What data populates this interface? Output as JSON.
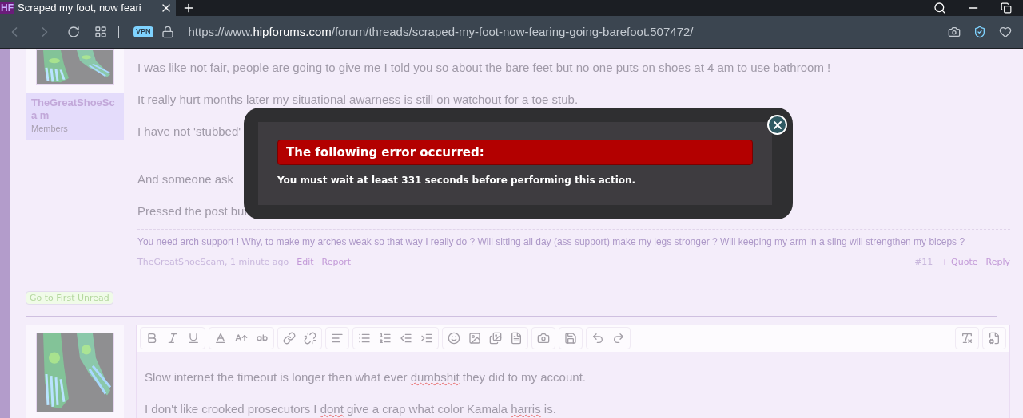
{
  "browser": {
    "tab": {
      "title": "Scraped my foot, now feari",
      "logo": "HF"
    },
    "address": {
      "vpn": "VPN",
      "prefix": "https://www.",
      "host": "hipforums.com",
      "path": "/forum/threads/scraped-my-foot-now-fearing-going-barefoot.507472/"
    }
  },
  "post": {
    "author": "TheGreatShoeSca m",
    "role": "Members",
    "paragraphs": [
      {
        "segments": [
          "I was like not fair, people are going to give me I told you so about the bare feet but no one puts on shoes at 4 am to use bathroom !"
        ]
      },
      {
        "segments": [
          "It really hurt months later my situational awarness is still on watchout for a toe stub."
        ]
      },
      {
        "segments": [
          "I have not 'stubbed'"
        ]
      },
      {
        "segments": [
          "And someone ask"
        ]
      },
      {
        "segments": [
          "Pressed the post but"
        ]
      }
    ],
    "signature": "You need arch support ! Why, to make my arches weak so that way I really do ? Will sitting all day (ass support) make my legs stronger ? Will keeping my arm in a sling will strengthen my biceps ?",
    "meta": {
      "byline": "TheGreatShoeScam, 1 minute ago",
      "links": [
        "Edit",
        "Report"
      ],
      "number": "#11",
      "actions": [
        "+ Quote",
        "Reply"
      ]
    }
  },
  "first_unread_button": "Go to First Unread",
  "editor": {
    "paragraphs": [
      [
        {
          "text": "Slow internet the timeout is longer then what ever ",
          "misspelled": false
        },
        {
          "text": "dumbshit",
          "misspelled": true
        },
        {
          "text": " they did to my account.",
          "misspelled": false
        }
      ],
      [
        {
          "text": "I don't like crooked prosecutors I ",
          "misspelled": false
        },
        {
          "text": "dont",
          "misspelled": true
        },
        {
          "text": " give a crap what color Kamala ",
          "misspelled": false
        },
        {
          "text": "harris",
          "misspelled": true
        },
        {
          "text": " is.",
          "misspelled": false
        }
      ]
    ]
  },
  "error_dialog": {
    "title": "The following error occurred:",
    "message": "You must wait at least 331 seconds before performing this action."
  }
}
